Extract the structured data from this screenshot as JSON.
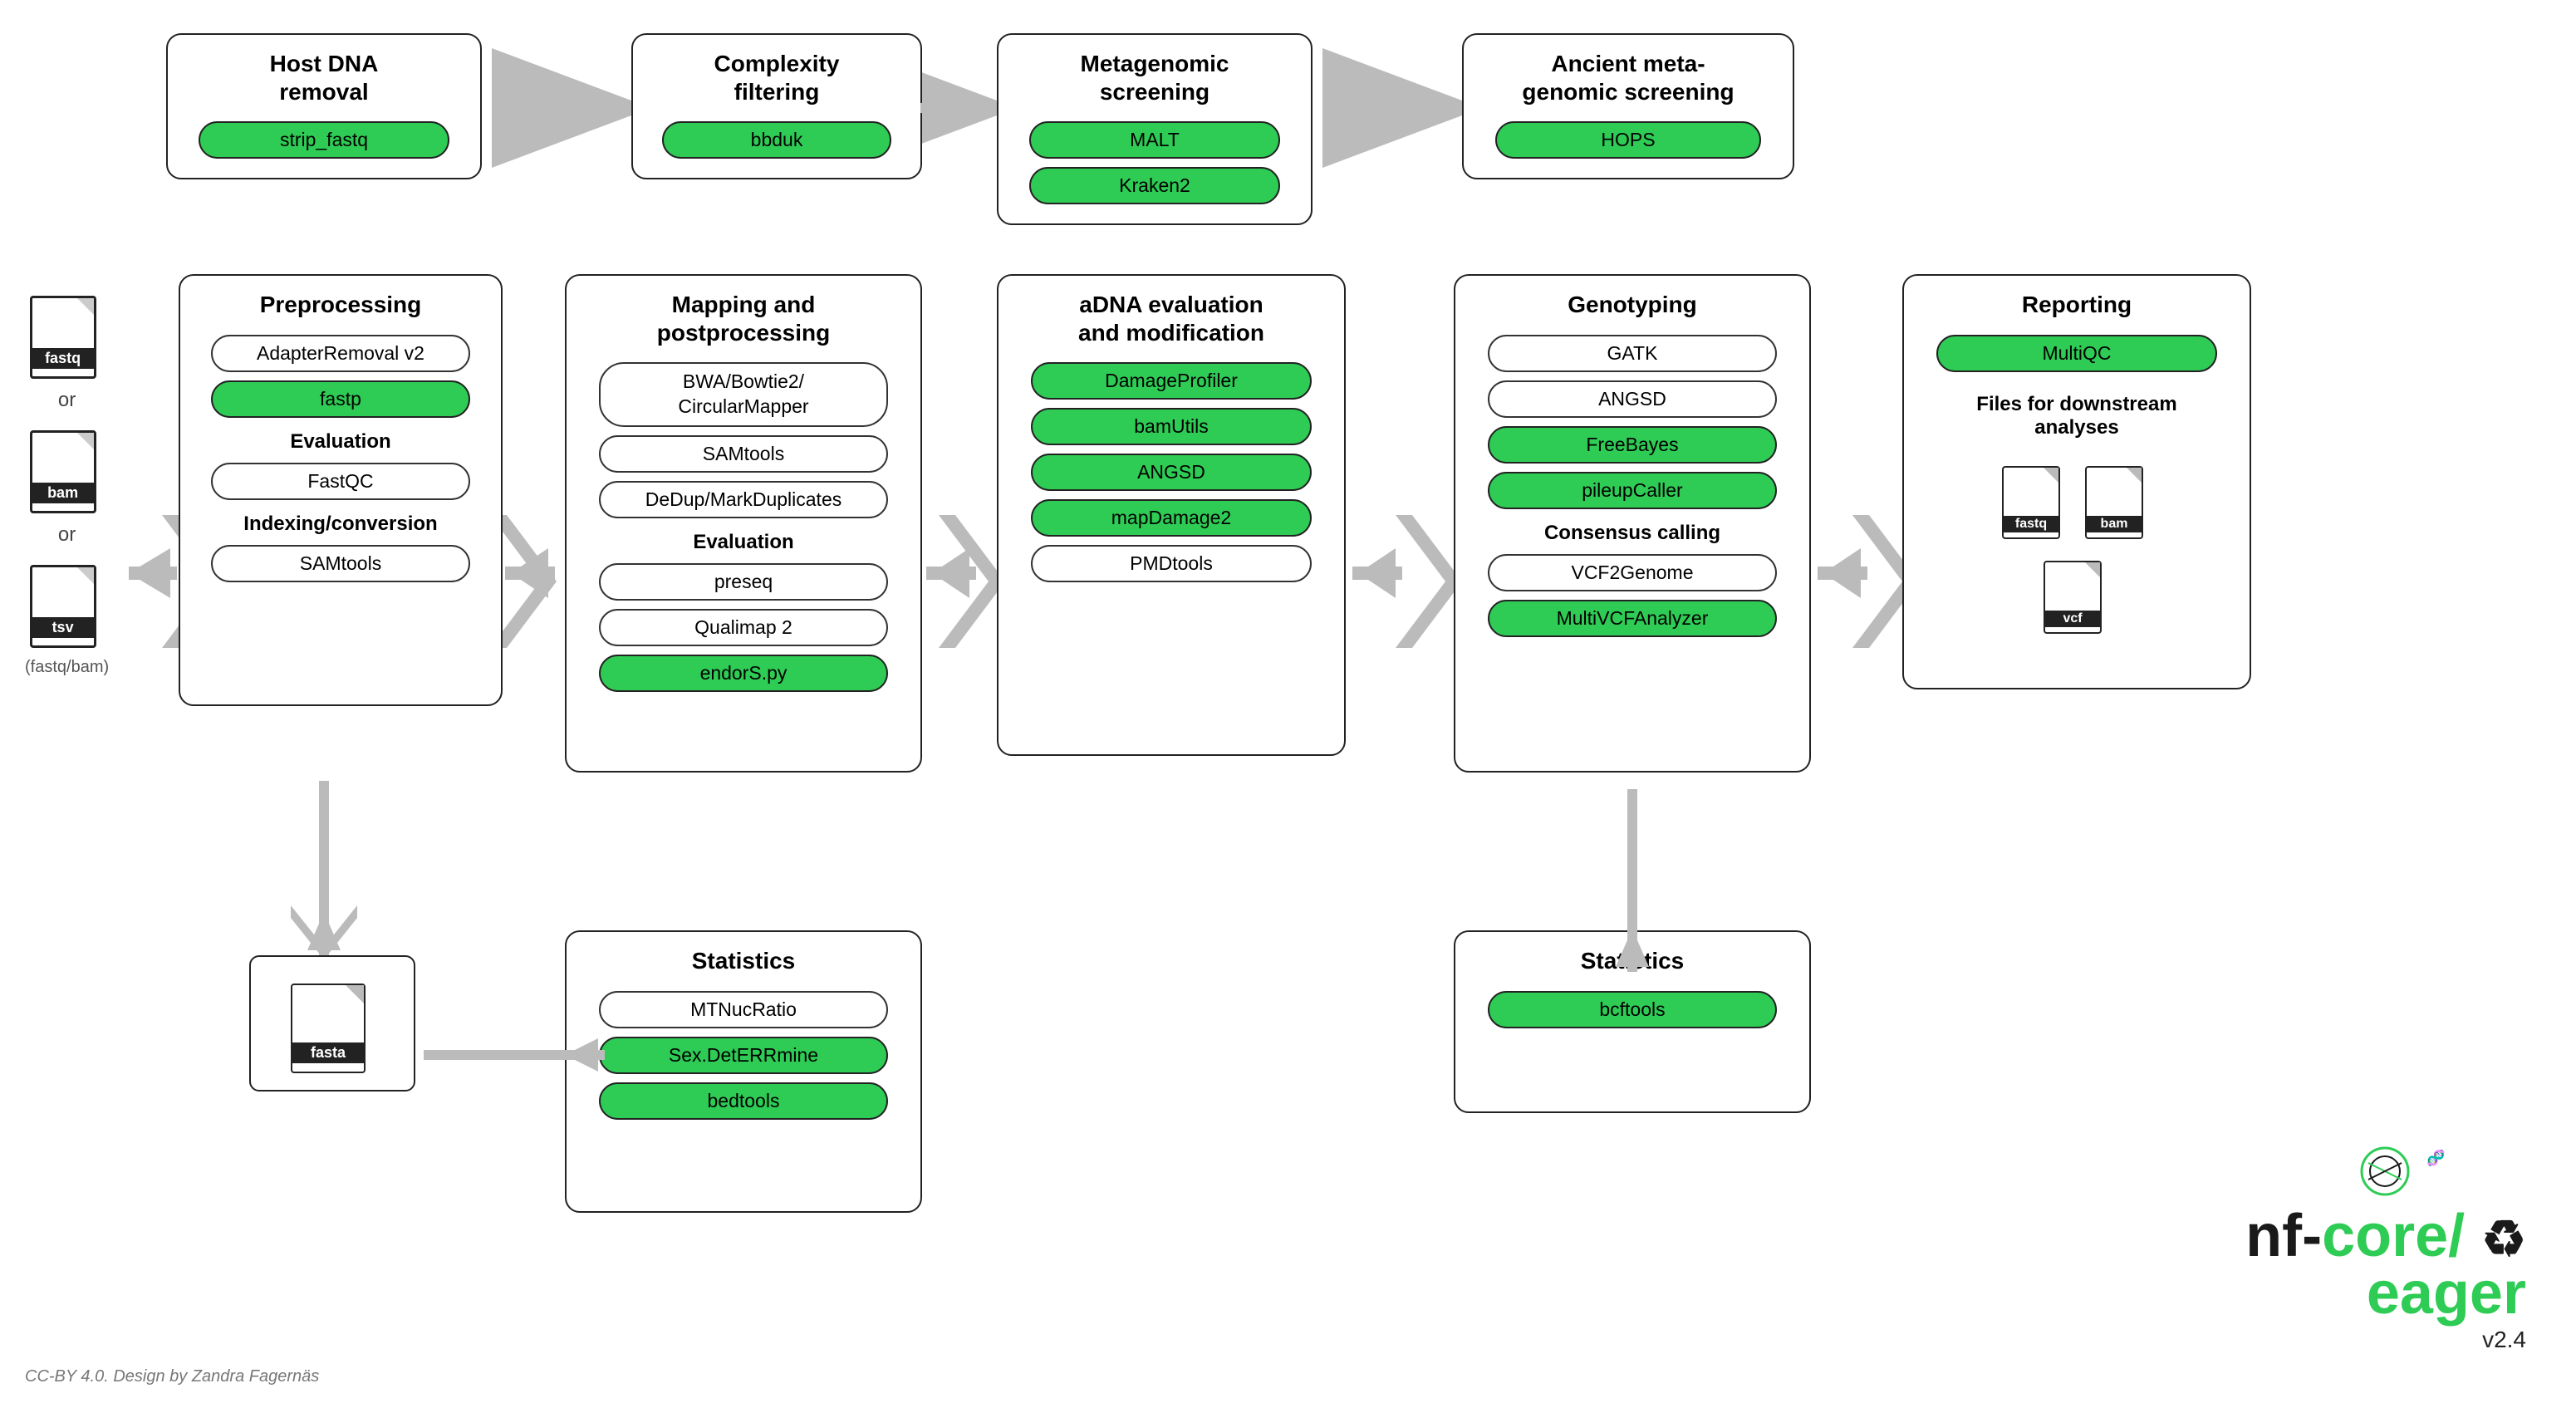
{
  "top_row": {
    "host_dna": {
      "title": "Host DNA\nremoval",
      "tools": [
        {
          "name": "strip_fastq",
          "green": true
        }
      ]
    },
    "complexity": {
      "title": "Complexity\nfiltering",
      "tools": [
        {
          "name": "bbduk",
          "green": true
        }
      ]
    },
    "metagenomic": {
      "title": "Metagenomic\nscreening",
      "tools": [
        {
          "name": "MALT",
          "green": true
        },
        {
          "name": "Kraken2",
          "green": true
        }
      ]
    },
    "ancient": {
      "title": "Ancient meta-\ngenomic screening",
      "tools": [
        {
          "name": "HOPS",
          "green": true
        }
      ]
    }
  },
  "input_files": {
    "fastq_label": "fastq",
    "or1": "or",
    "bam_label": "bam",
    "or2": "or",
    "tsv_label": "tsv",
    "subtext": "(fastq/bam)"
  },
  "preprocessing": {
    "title": "Preprocessing",
    "tools_preprocessing": [
      {
        "name": "AdapterRemoval v2",
        "green": false
      },
      {
        "name": "fastp",
        "green": true
      }
    ],
    "evaluation_title": "Evaluation",
    "tools_evaluation": [
      {
        "name": "FastQC",
        "green": false
      }
    ],
    "indexing_title": "Indexing/conversion",
    "tools_indexing": [
      {
        "name": "SAMtools",
        "green": false
      }
    ]
  },
  "mapping": {
    "title": "Mapping and\npostprocessing",
    "tools_mapping": [
      {
        "name": "BWA/Bowtie2/\nCircularMapper",
        "green": false
      },
      {
        "name": "SAMtools",
        "green": false
      },
      {
        "name": "DeDup/MarkDuplicates",
        "green": false
      }
    ],
    "evaluation_title": "Evaluation",
    "tools_evaluation": [
      {
        "name": "preseq",
        "green": false
      },
      {
        "name": "Qualimap 2",
        "green": false
      },
      {
        "name": "endorS.py",
        "green": true
      }
    ]
  },
  "adna": {
    "title": "aDNA evaluation\nand modification",
    "tools": [
      {
        "name": "DamageProfiler",
        "green": true
      },
      {
        "name": "bamUtils",
        "green": true
      },
      {
        "name": "ANGSD",
        "green": true
      },
      {
        "name": "mapDamage2",
        "green": true
      },
      {
        "name": "PMDtools",
        "green": false
      }
    ]
  },
  "genotyping": {
    "title": "Genotyping",
    "tools_genotyping": [
      {
        "name": "GATK",
        "green": false
      },
      {
        "name": "ANGSD",
        "green": false
      },
      {
        "name": "FreeBayes",
        "green": true
      },
      {
        "name": "pileupCaller",
        "green": true
      }
    ],
    "consensus_title": "Consensus calling",
    "tools_consensus": [
      {
        "name": "VCF2Genome",
        "green": false
      },
      {
        "name": "MultiVCFAnalyzer",
        "green": true
      }
    ]
  },
  "reporting": {
    "title": "Reporting",
    "tools": [
      {
        "name": "MultiQC",
        "green": true
      }
    ],
    "downstream_title": "Files for downstream\nanalyses",
    "output_files": [
      "fastq",
      "bam",
      "vcf"
    ]
  },
  "fasta_file": {
    "label": "fasta"
  },
  "statistics_left": {
    "title": "Statistics",
    "tools": [
      {
        "name": "MTNucRatio",
        "green": false
      },
      {
        "name": "Sex.DetERRmine",
        "green": true
      },
      {
        "name": "bedtools",
        "green": true
      }
    ]
  },
  "statistics_right": {
    "title": "Statistics",
    "tools": [
      {
        "name": "bcftools",
        "green": true
      }
    ]
  },
  "logo": {
    "nf": "nf-",
    "core": "core/",
    "eager": "eager",
    "version": "v2.4"
  },
  "cc_text": "CC-BY 4.0. Design by Zandra Fagernäs"
}
